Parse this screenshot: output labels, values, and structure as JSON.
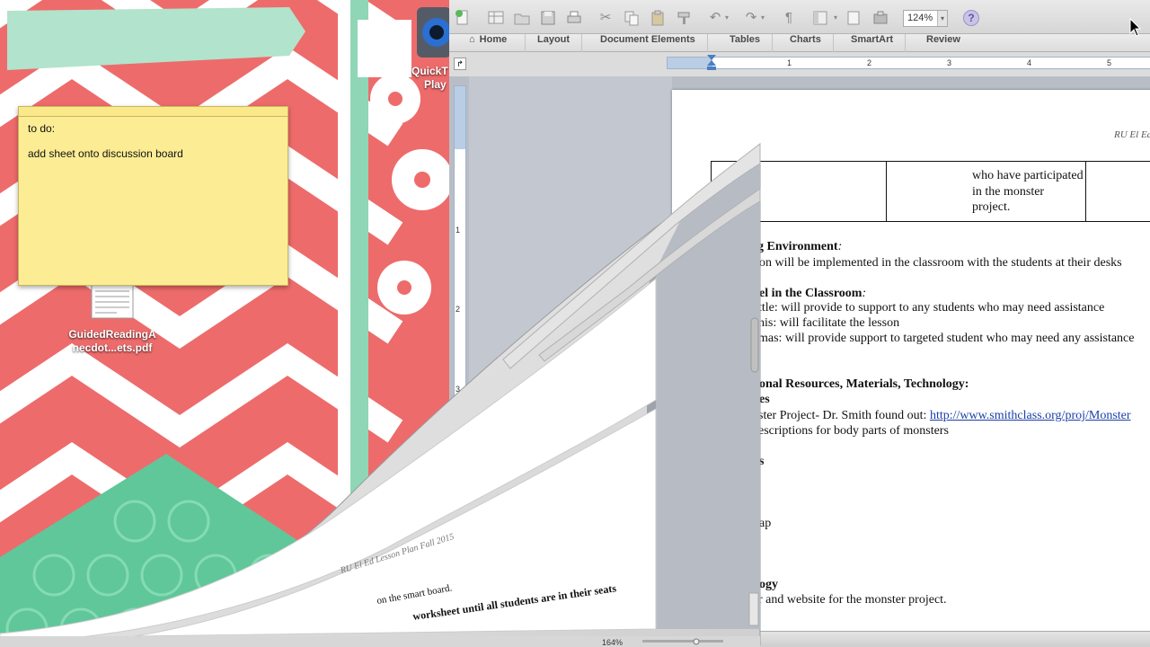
{
  "desktop": {
    "quicktime_label_line1": "QuickT",
    "quicktime_label_line2": "Play",
    "pdf_label_line1": "GuidedReadingA",
    "pdf_label_line2": "necdot...ets.pdf"
  },
  "sticky_note": {
    "line1": "to do:",
    "line2": "add sheet onto discussion board"
  },
  "word": {
    "zoom": "124%",
    "tabs": [
      "Home",
      "Layout",
      "Document Elements",
      "Tables",
      "Charts",
      "SmartArt",
      "Review"
    ],
    "ruler_numbers": [
      "1",
      "2",
      "3",
      "4",
      "5"
    ],
    "vruler_numbers": [
      "1",
      "2",
      "3"
    ],
    "status_zoom": "164%",
    "document": {
      "header": "RU El Ed",
      "table_cell": "who have participated in the monster project.",
      "lines": [
        {
          "bold": "g Environment",
          "rest": ":"
        },
        {
          "bold": "",
          "rest": "on will be implemented in the classroom with the students at their desks"
        },
        {
          "bold": "el in the Classroom",
          "rest": ":"
        },
        {
          "bold": "",
          "rest": "ttle: will provide to support to any students who may need assistance"
        },
        {
          "bold": "",
          "rest": "his: will facilitate the lesson"
        },
        {
          "bold": "",
          "rest": "mas: will provide support to targeted student who may need any assistance"
        },
        {
          "bold": "onal Resources, Materials, Technology:",
          "rest": ""
        },
        {
          "bold": "es",
          "rest": ""
        },
        {
          "bold": "",
          "rest": "ster Project- Dr. Smith found out: "
        },
        {
          "bold": "",
          "rest": "escriptions for body parts of monsters"
        },
        {
          "bold": "s",
          "rest": ""
        },
        {
          "bold": "",
          "rest": "ap"
        },
        {
          "bold": "ogy",
          "rest": ""
        },
        {
          "bold": "",
          "rest": "r and website for the monster project."
        }
      ],
      "link": "http://www.smithclass.org/proj/Monster"
    },
    "minimizing_page_text": {
      "header": "RU El Ed Lesson Plan Fall 2015",
      "line_a": "on the smart board.",
      "line_b": "worksheet until all students are in their seats"
    }
  },
  "colors": {
    "wallpaper_coral": "#ee6b6b",
    "wallpaper_mint": "#8fd6b6",
    "sticky_yellow": "#fcec94",
    "link_blue": "#1a3ea8"
  }
}
